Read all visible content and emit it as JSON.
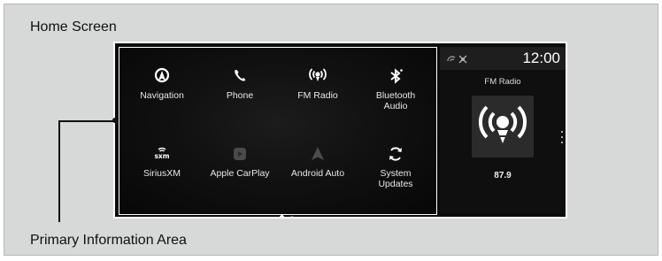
{
  "captions": {
    "top": "Home Screen",
    "bottom": "Primary Information Area"
  },
  "apps": [
    {
      "label": "Navigation",
      "icon": "navigation-icon"
    },
    {
      "label": "Phone",
      "icon": "phone-icon"
    },
    {
      "label": "FM Radio",
      "icon": "radio-icon"
    },
    {
      "label": "Bluetooth\nAudio",
      "icon": "bluetooth-icon"
    },
    {
      "label": "SiriusXM",
      "icon": "siriusxm-icon"
    },
    {
      "label": "Apple CarPlay",
      "icon": "carplay-icon"
    },
    {
      "label": "Android Auto",
      "icon": "android-auto-icon"
    },
    {
      "label": "System\nUpdates",
      "icon": "system-updates-icon"
    }
  ],
  "status": {
    "clock": "12:00"
  },
  "side_panel": {
    "title": "FM Radio",
    "frequency": "87.9"
  },
  "pager": {
    "pages": 2,
    "current": 1
  },
  "colors": {
    "screen_bg": "#0b0b0b",
    "frame_bg": "#d7d8d8",
    "text": "#e8e8e8"
  }
}
